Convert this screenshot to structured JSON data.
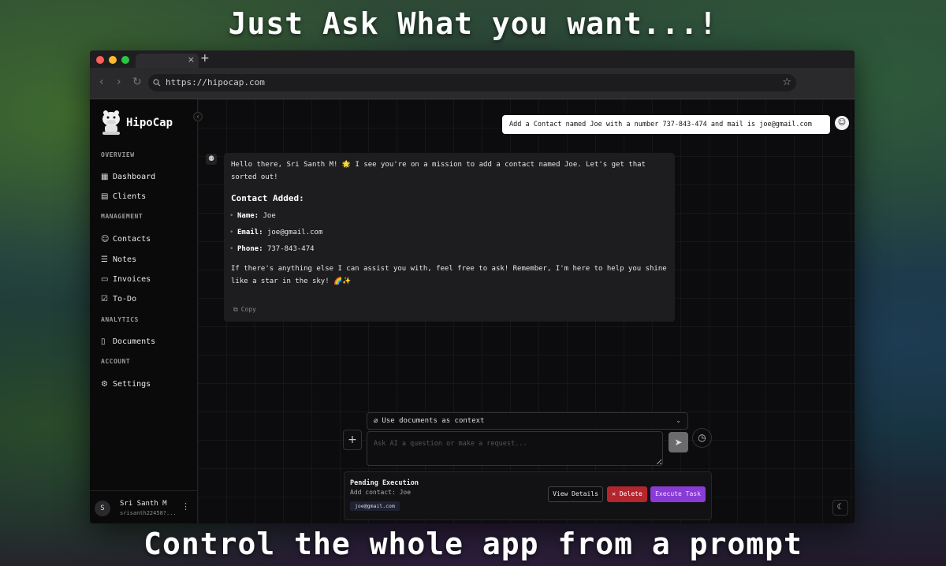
{
  "headline_top": "Just Ask What you want...!",
  "headline_bottom": "Control the whole app from a prompt",
  "browser": {
    "tab_close": "×",
    "tab_new": "+",
    "url": "https://hipocap.com"
  },
  "sidebar": {
    "brand": "HipoCap",
    "sections": {
      "overview": "OVERVIEW",
      "management": "MANAGEMENT",
      "analytics": "ANALYTICS",
      "account": "ACCOUNT"
    },
    "items": {
      "dashboard": "Dashboard",
      "clients": "Clients",
      "contacts": "Contacts",
      "notes": "Notes",
      "invoices": "Invoices",
      "todo": "To-Do",
      "documents": "Documents",
      "settings": "Settings"
    },
    "user": {
      "initial": "S",
      "name": "Sri Santh M",
      "email": "srisanth22458?..."
    }
  },
  "chat": {
    "user_message": "Add a Contact named Joe with a number 737-843-474 and mail is joe@gmail.com",
    "bot_intro": "Hello there, Sri Santh M! 🌟 I see you're on a mission to add a contact named Joe. Let's get that sorted out!",
    "bot_heading": "Contact Added:",
    "fields": [
      {
        "label": "Name:",
        "value": "Joe"
      },
      {
        "label": "Email:",
        "value": "joe@gmail.com"
      },
      {
        "label": "Phone:",
        "value": "737-843-474"
      }
    ],
    "bot_outro": "If there's anything else I can assist you with, feel free to ask! Remember, I'm here to help you shine like a star in the sky! 🌈✨",
    "copy_label": "Copy"
  },
  "composer": {
    "context_label": "Use documents as context",
    "placeholder": "Ask AI a question or make a request..."
  },
  "pending": {
    "title": "Pending Execution",
    "subtitle": "Add contact: Joe",
    "chip": "joe@gmail.com",
    "view_label": "View Details",
    "delete_label": "✕ Delete",
    "execute_label": "Execute Task"
  }
}
